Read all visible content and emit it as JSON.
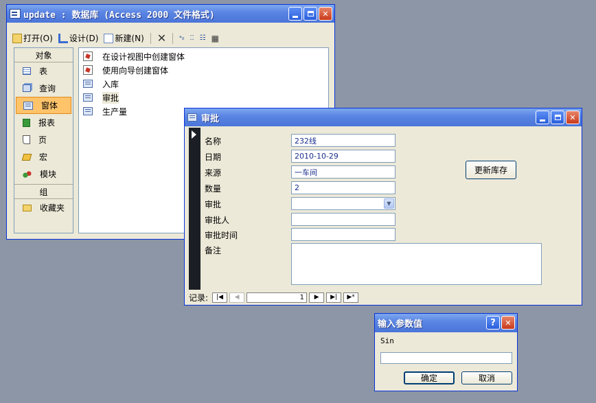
{
  "db_window": {
    "title": "update : 数据库 (Access 2000 文件格式)",
    "toolbar": {
      "open_label": "打开(O)",
      "design_label": "设计(D)",
      "new_label": "新建(N)"
    },
    "objects_header": "对象",
    "objects": [
      {
        "label": "表",
        "icon": "table-icon"
      },
      {
        "label": "查询",
        "icon": "query-icon"
      },
      {
        "label": "窗体",
        "icon": "form-icon",
        "selected": true
      },
      {
        "label": "报表",
        "icon": "report-icon"
      },
      {
        "label": "页",
        "icon": "page-icon"
      },
      {
        "label": "宏",
        "icon": "macro-icon"
      },
      {
        "label": "模块",
        "icon": "module-icon"
      }
    ],
    "groups_header": "组",
    "groups": [
      {
        "label": "收藏夹",
        "icon": "favorites-folder-icon"
      }
    ],
    "items": [
      {
        "label": "在设计视图中创建窗体",
        "icon": "design-wizard-icon"
      },
      {
        "label": "使用向导创建窗体",
        "icon": "form-wizard-icon"
      },
      {
        "label": "入库",
        "icon": "form-icon"
      },
      {
        "label": "审批",
        "icon": "form-icon"
      },
      {
        "label": "生产量",
        "icon": "form-icon"
      }
    ]
  },
  "form_window": {
    "title": "审批",
    "fields": [
      {
        "label": "名称",
        "value": "232线"
      },
      {
        "label": "日期",
        "value": "2010-10-29"
      },
      {
        "label": "来源",
        "value": "一车间"
      },
      {
        "label": "数量",
        "value": "2"
      },
      {
        "label": "审批",
        "value": ""
      },
      {
        "label": "审批人",
        "value": ""
      },
      {
        "label": "审批时间",
        "value": ""
      },
      {
        "label": "备注",
        "value": ""
      }
    ],
    "update_button": "更新库存",
    "record_label": "记录:",
    "record_number": "1"
  },
  "param_dialog": {
    "title": "输入参数值",
    "prompt": "Sin",
    "input_value": "",
    "ok_label": "确定",
    "cancel_label": "取消"
  }
}
